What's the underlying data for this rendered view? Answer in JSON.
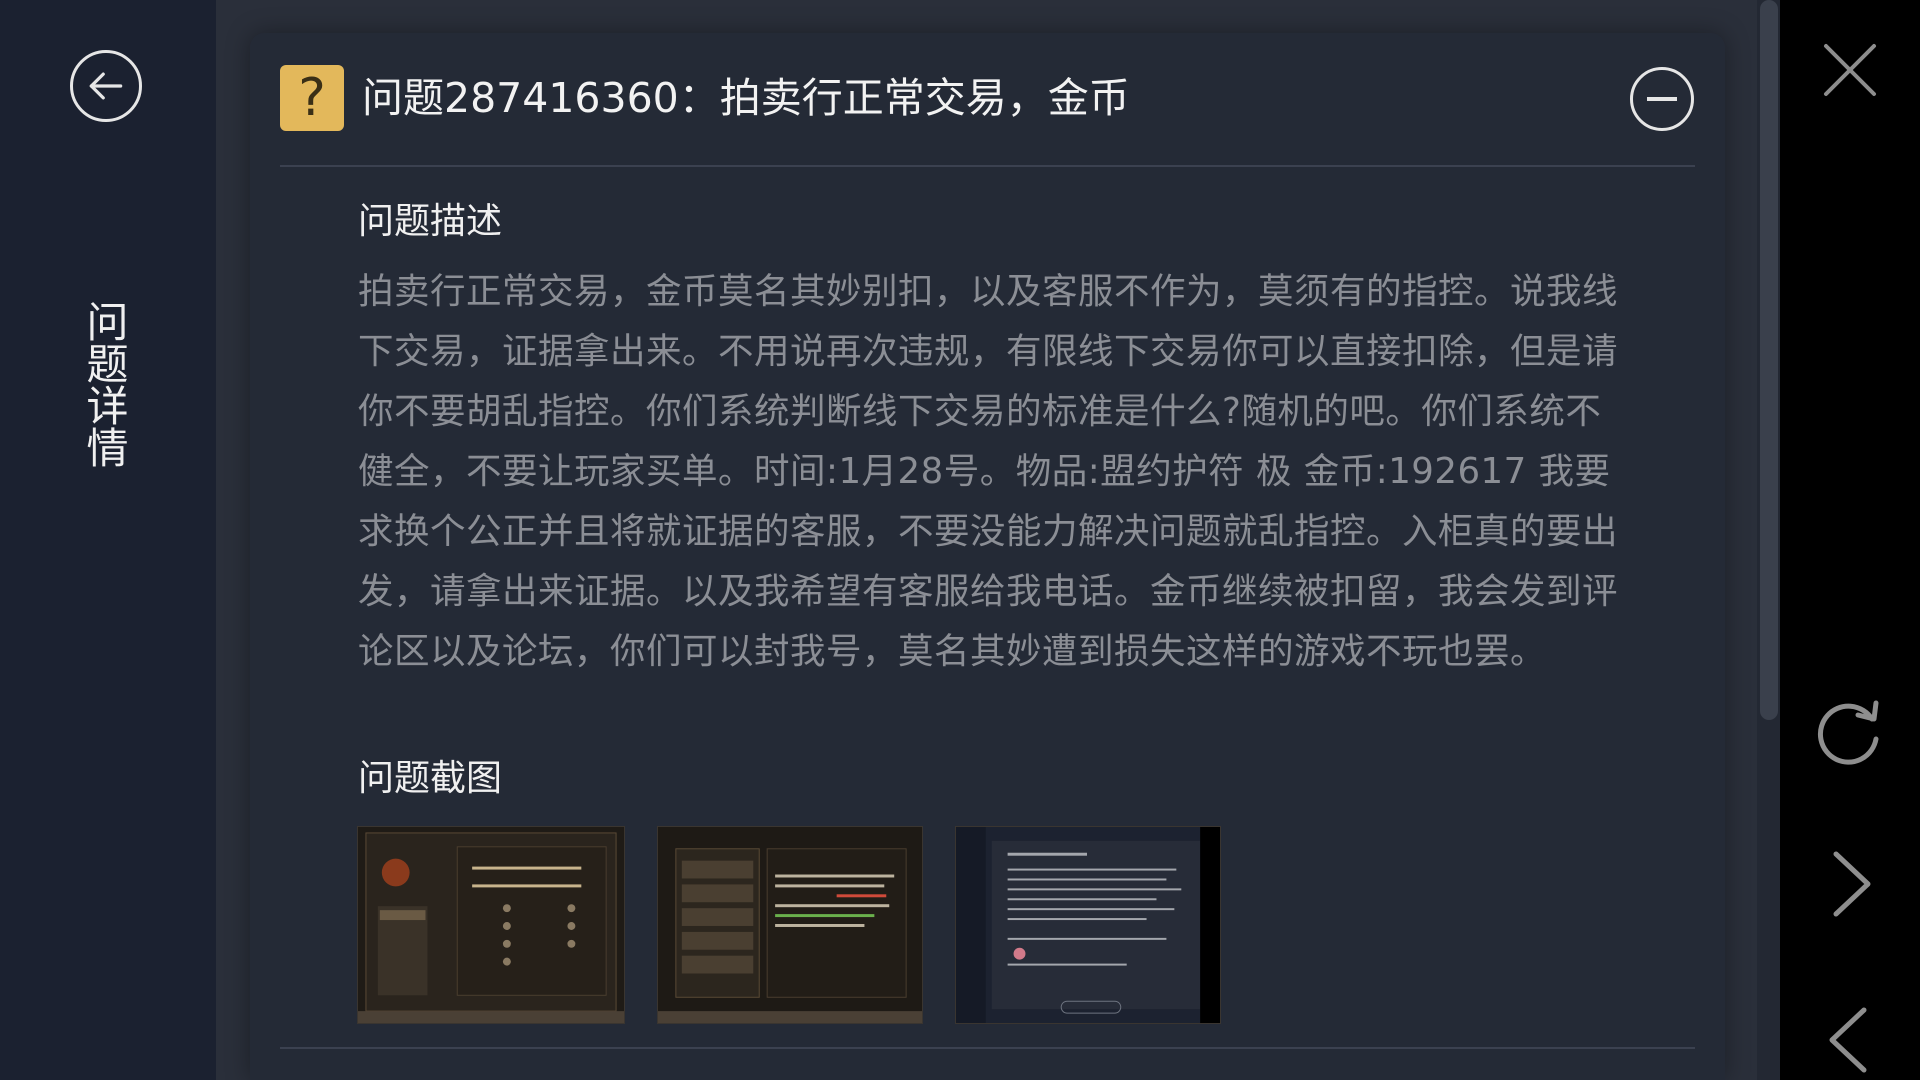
{
  "sidebar": {
    "title": "问题详情",
    "back_icon": "back-arrow-icon"
  },
  "question": {
    "icon": "question-mark-icon",
    "icon_glyph": "?",
    "title": "问题287416360：拍卖行正常交易，金币",
    "collapse_icon": "minus-circle-icon"
  },
  "description": {
    "heading": "问题描述",
    "text": "拍卖行正常交易，金币莫名其妙别扣，以及客服不作为，莫须有的指控。说我线下交易，证据拿出来。不用说再次违规，有限线下交易你可以直接扣除，但是请你不要胡乱指控。你们系统判断线下交易的标准是什么?随机的吧。你们系统不健全，不要让玩家买单。时间:1月28号。物品:盟约护符 极 金币:192617 我要求换个公正并且将就证据的客服，不要没能力解决问题就乱指控。入柜真的要出发，请拿出来证据。以及我希望有客服给我电话。金币继续被扣留，我会发到评论区以及论坛，你们可以封我号，莫名其妙遭到损失这样的游戏不玩也罢。"
  },
  "screenshots": {
    "heading": "问题截图",
    "items": [
      {
        "name": "screenshot-thumbnail-1",
        "kind": "game-settings-screen"
      },
      {
        "name": "screenshot-thumbnail-2",
        "kind": "game-trade-log-screen"
      },
      {
        "name": "screenshot-thumbnail-3",
        "kind": "game-chat-screen"
      }
    ]
  },
  "right_rail": {
    "icons": [
      "close-icon",
      "refresh-icon",
      "chevron-right-icon",
      "chevron-left-icon"
    ]
  },
  "colors": {
    "background": "#2a2f3a",
    "sidebar": "#1b2130",
    "panel": "#242a36",
    "accent": "#e3b85b",
    "text_muted": "#8b8e95"
  }
}
